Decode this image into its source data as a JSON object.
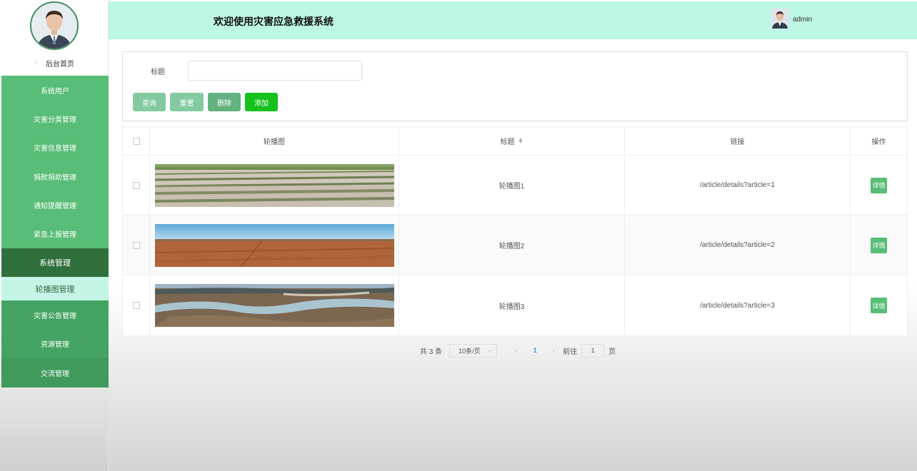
{
  "header": {
    "title": "欢迎使用灾害应急救援系统",
    "username": "admin"
  },
  "sidebar": {
    "home_label": "后台首页",
    "items": [
      {
        "label": "系统用户"
      },
      {
        "label": "灾害分类管理"
      },
      {
        "label": "灾害信息管理"
      },
      {
        "label": "捐款捐助管理"
      },
      {
        "label": "通知提醒管理"
      },
      {
        "label": "紧急上报管理"
      },
      {
        "label": "系统管理"
      },
      {
        "label": "轮播图管理"
      },
      {
        "label": "灾害公告管理"
      },
      {
        "label": "资源管理"
      },
      {
        "label": "交流管理"
      }
    ]
  },
  "search": {
    "label": "标题",
    "value": "",
    "placeholder": ""
  },
  "buttons": {
    "query": "查询",
    "reset": "重置",
    "delete": "删除",
    "add": "添加"
  },
  "table": {
    "columns": {
      "image": "轮播图",
      "title": "标题",
      "link": "链接",
      "operation": "操作"
    },
    "rows": [
      {
        "title": "轮播图1",
        "link": "/article/details?article=1",
        "action": "详情"
      },
      {
        "title": "轮播图2",
        "link": "/article/details?article=2",
        "action": "详情"
      },
      {
        "title": "轮播图3",
        "link": "/article/details?article=3",
        "action": "详情"
      }
    ]
  },
  "pagination": {
    "total": "共 3 条",
    "page_size": "10条/页",
    "current_page": "1",
    "goto_label": "前往",
    "goto_value": "1",
    "page_suffix": "页"
  },
  "colors": {
    "sidebar_menu": "#58bd76",
    "sidebar_active": "#2f6f3c",
    "sidebar_sub_active": "#c4f5e4",
    "header_bg": "#bdf7e5",
    "add_button": "#16c11d",
    "page_active": "#409eff"
  }
}
